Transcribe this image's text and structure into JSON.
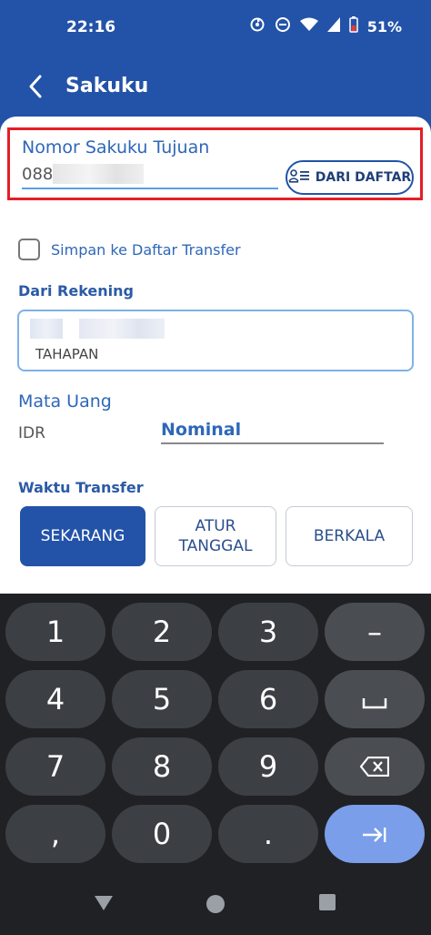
{
  "status_bar": {
    "time": "22:16",
    "battery": "51%",
    "icons": [
      "sync-icon",
      "dnd-icon",
      "wifi-icon",
      "signal-icon",
      "battery-icon"
    ]
  },
  "app_bar": {
    "title": "Sakuku",
    "back_icon": "back-arrow-icon"
  },
  "destination": {
    "label": "Nomor Sakuku Tujuan",
    "value_visible": "088",
    "from_list_button": "DARI DAFTAR",
    "highlight_color": "#e41e26"
  },
  "save_to_list": {
    "label": "Simpan ke Daftar Transfer",
    "checked": false
  },
  "source_account": {
    "label": "Dari Rekening",
    "account_type": "TAHAPAN"
  },
  "currency": {
    "label": "Mata Uang",
    "value": "IDR"
  },
  "amount": {
    "placeholder": "Nominal"
  },
  "transfer_time": {
    "label": "Waktu Transfer",
    "options": [
      {
        "label": "SEKARANG",
        "selected": true
      },
      {
        "label": "ATUR TANGGAL",
        "selected": false
      },
      {
        "label": "BERKALA",
        "selected": false
      }
    ]
  },
  "keyboard": {
    "rows": [
      [
        "1",
        "2",
        "3",
        "–"
      ],
      [
        "4",
        "5",
        "6",
        "space"
      ],
      [
        "7",
        "8",
        "9",
        "backspace"
      ],
      [
        ",",
        "0",
        ".",
        "enter"
      ]
    ]
  },
  "colors": {
    "primary": "#2353a8",
    "label_blue": "#2e67b8",
    "keyboard_bg": "#202124",
    "key_bg": "#3c3f44",
    "enter_key": "#7a9ee9"
  }
}
